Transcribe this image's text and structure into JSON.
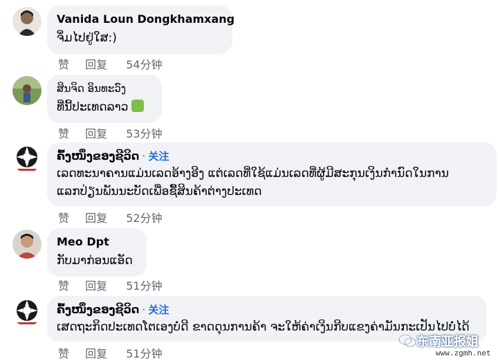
{
  "comments": [
    {
      "author": "Vanida Loun Dongkhamxang",
      "text_lines": [
        "ຈິ່ມໄປຢູ່ໃສ:)"
      ],
      "follow_label": "",
      "like": "赞",
      "reply": "回复",
      "time": "54分钟",
      "avatar_color": "#8b6a52"
    },
    {
      "author": "ສິນຈິດ ອິນທະວົງ",
      "text_lines": [
        "ທີ່ນີ້ປະເທດລາວ"
      ],
      "follow_label": "",
      "like": "赞",
      "reply": "回复",
      "time": "53分钟",
      "avatar_color": "#5e7a4a"
    },
    {
      "author": "ຄົ້ງໜຶ່ງຂອງຊີວິດ",
      "text_lines": [
        "ເລດທະນາຄານແມ່ນເລດອ້າງອີງ ແຕ່ເລດທີ່ໃຊ້ແມ່ນເລດທີ່ຜູ້ມີສະກຸນເງິນກໍານົດໃນການ",
        "ແລກປ່ຽນພັນນະບັດເພື່ອຊື້ສິນຄ້າຕ່າງປະເທດ"
      ],
      "follow_sep": "·",
      "follow_label": "关注",
      "like": "赞",
      "reply": "回复",
      "time": "52分钟",
      "avatar_color": "#1a1a1a"
    },
    {
      "author": "Meo Dpt",
      "text_lines": [
        "ກັບມາກ່ອນແອັດ"
      ],
      "follow_label": "",
      "like": "赞",
      "reply": "回复",
      "time": "51分钟",
      "avatar_color": "#b84a3a"
    },
    {
      "author": "ຄົ້ງໜຶ່ງຂອງຊີວິດ",
      "text_lines": [
        "ເສດຖະກິດປະເທດໂຕເອງບໍ່ດີ ຂາດດຸນການຄ້າ ຈະໃຫ້ຄ່າເງິນກີບແຂງຄ່າມັນກະເປັນໄປບໍ່ໄດ້"
      ],
      "follow_sep": "·",
      "follow_label": "关注",
      "like": "赞",
      "reply": "回复",
      "time": "51分钟",
      "avatar_color": "#1a1a1a"
    }
  ],
  "watermark": {
    "title": "东南亚报姐",
    "url": "www.zgmh.net"
  },
  "colors": {
    "bubble": "#f0f2f5",
    "follow": "#216fdb",
    "meta": "#65676b"
  }
}
